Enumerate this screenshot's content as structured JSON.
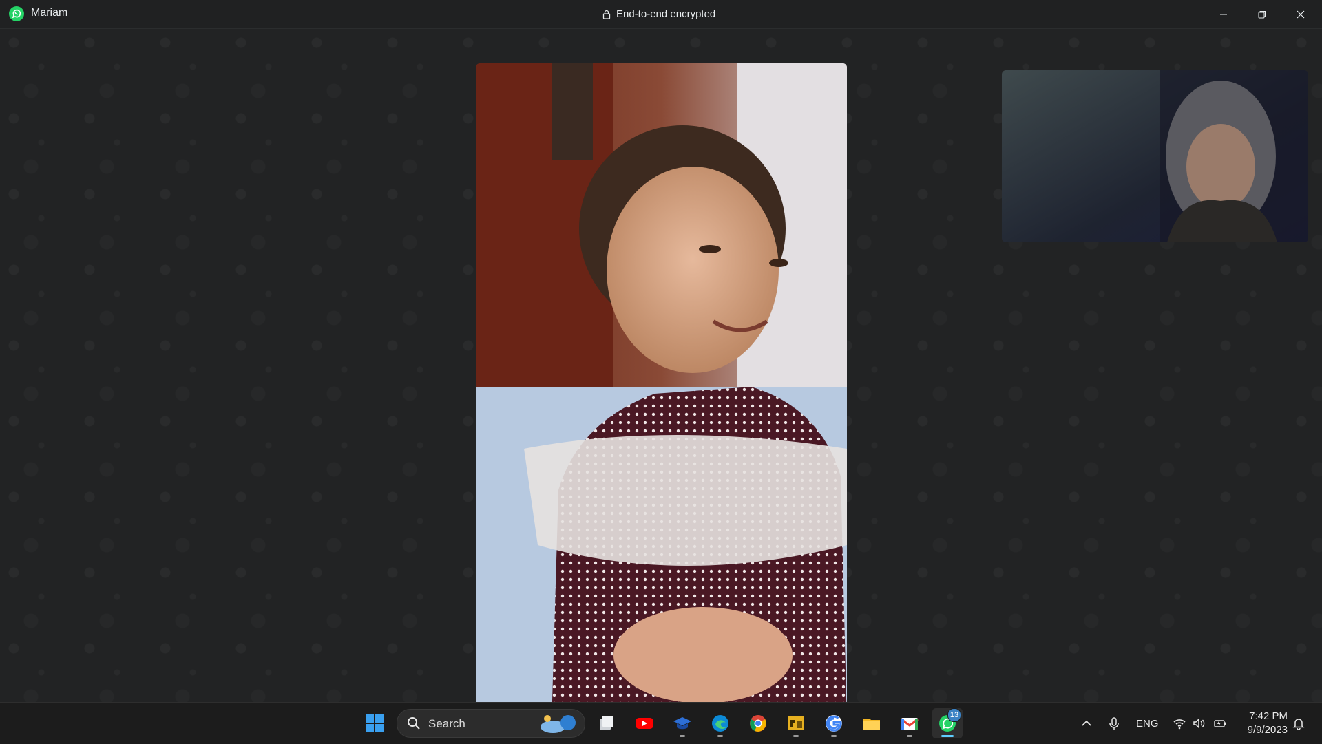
{
  "window": {
    "contact_name": "Mariam",
    "encryption_label": "End-to-end encrypted",
    "controls": [
      "minimize-icon",
      "restore-icon",
      "close-icon"
    ]
  },
  "call": {
    "remote_video": "remote-participant-video",
    "self_video": "self-view-video"
  },
  "taskbar": {
    "search_label": "Search",
    "pinned": [
      {
        "name": "start-button",
        "icon": "windows-logo-icon"
      },
      {
        "name": "task-view-button",
        "icon": "task-view-icon"
      },
      {
        "name": "youtube-button",
        "icon": "youtube-icon"
      },
      {
        "name": "learning-app-button",
        "icon": "graduation-cap-icon"
      },
      {
        "name": "edge-button",
        "icon": "edge-icon"
      },
      {
        "name": "chrome-button",
        "icon": "chrome-icon"
      },
      {
        "name": "game-app-button",
        "icon": "game-icon"
      },
      {
        "name": "google-button",
        "icon": "google-icon"
      },
      {
        "name": "file-explorer-button",
        "icon": "folder-icon"
      },
      {
        "name": "gmail-button",
        "icon": "gmail-icon"
      },
      {
        "name": "whatsapp-button",
        "icon": "whatsapp-icon",
        "badge": "13"
      }
    ],
    "tray": {
      "language": "ENG",
      "time": "7:42 PM",
      "date": "9/9/2023"
    }
  },
  "colors": {
    "background": "#222324",
    "whatsapp_green": "#25d366",
    "taskbar_accent": "#60cdff"
  }
}
